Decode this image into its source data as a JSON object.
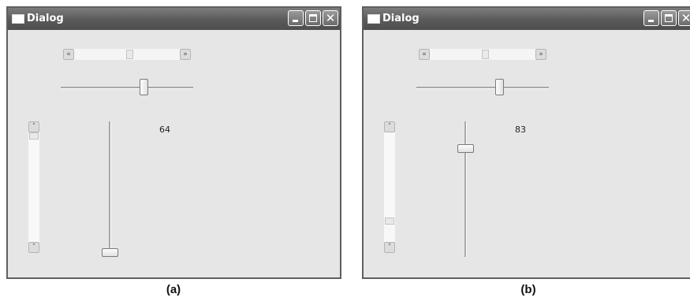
{
  "windows": [
    {
      "title": "Dialog",
      "title_icon": "window-icon",
      "buttons": {
        "minimize": "minimize-icon",
        "maximize": "maximize-icon",
        "close": "close-icon",
        "close_glyph": "✕"
      },
      "arrows": {
        "left": "«",
        "right": "»",
        "up": "˄",
        "down": "˅"
      },
      "value": "64",
      "levels": {
        "hscroll": 0.53,
        "hslider": 0.64,
        "vscroll": 0.0,
        "vslider": 0.0
      },
      "caption": "(a)"
    },
    {
      "title": "Dialog",
      "title_icon": "window-icon",
      "buttons": {
        "minimize": "minimize-icon",
        "maximize": "maximize-icon",
        "close": "close-icon",
        "close_glyph": "✕"
      },
      "arrows": {
        "left": "«",
        "right": "»",
        "up": "˄",
        "down": "˅"
      },
      "value": "83",
      "levels": {
        "hscroll": 0.53,
        "hslider": 0.64,
        "vscroll": 0.83,
        "vslider": 0.82
      },
      "caption": "(b)"
    }
  ],
  "colors": {
    "titlebar": "#5a5a5a",
    "window_bg": "#e6e6e6",
    "border": "#5f5f5f"
  }
}
